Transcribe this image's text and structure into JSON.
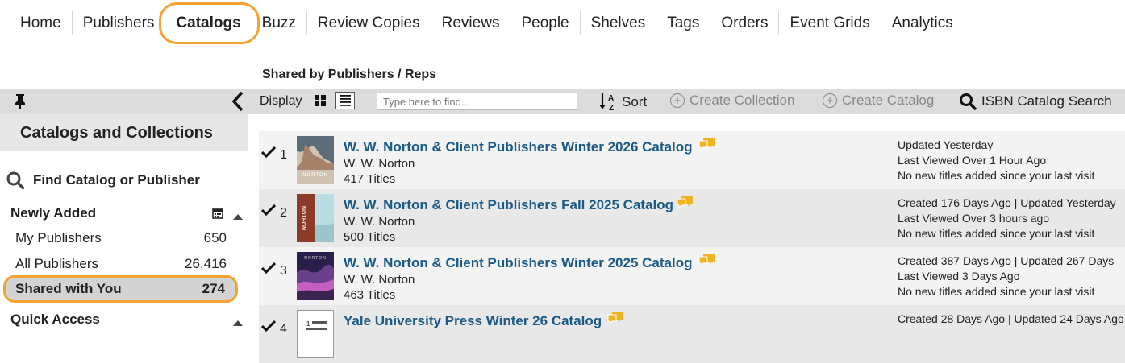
{
  "nav": {
    "items": [
      {
        "label": "Home"
      },
      {
        "label": "Publishers"
      },
      {
        "label": "Catalogs"
      },
      {
        "label": "Buzz"
      },
      {
        "label": "Review Copies"
      },
      {
        "label": "Reviews"
      },
      {
        "label": "People"
      },
      {
        "label": "Shelves"
      },
      {
        "label": "Tags"
      },
      {
        "label": "Orders"
      },
      {
        "label": "Event Grids"
      },
      {
        "label": "Analytics"
      }
    ],
    "active": "Catalogs"
  },
  "section_label": "Shared by Publishers / Reps",
  "toolbar": {
    "display_label": "Display",
    "find_placeholder": "Type here to find...",
    "sort_label": "Sort",
    "create_collection_label": "Create Collection",
    "create_catalog_label": "Create Catalog",
    "isbn_search_label": "ISBN Catalog Search"
  },
  "sidebar": {
    "title": "Catalogs and Collections",
    "find_label": "Find Catalog or Publisher",
    "newly_added_label": "Newly Added",
    "items": [
      {
        "label": "My Publishers",
        "count": "650"
      },
      {
        "label": "All Publishers",
        "count": "26,416"
      },
      {
        "label": "Shared with You",
        "count": "274"
      }
    ],
    "quick_access_label": "Quick Access"
  },
  "catalogs": [
    {
      "index": "1",
      "title": "W. W. Norton & Client Publishers Winter 2026 Catalog",
      "publisher": "W. W. Norton",
      "titles": "417 Titles",
      "meta_line1": "Updated Yesterday",
      "meta_line2": "Last Viewed Over 1 Hour Ago",
      "meta_line3": "No new titles added since your last visit",
      "cover_text": "NORTON"
    },
    {
      "index": "2",
      "title": "W. W. Norton & Client Publishers Fall 2025 Catalog",
      "publisher": "W. W. Norton",
      "titles": "500 Titles",
      "meta_line1": "Created 176 Days Ago  |  Updated Yesterday",
      "meta_line2": "Last Viewed Over 3 hours ago",
      "meta_line3": "No new titles added since your last visit",
      "cover_text": "NORTON"
    },
    {
      "index": "3",
      "title": "W. W. Norton & Client Publishers Winter 2025 Catalog",
      "publisher": "W. W. Norton",
      "titles": "463 Titles",
      "meta_line1": "Created 387 Days Ago  |  Updated 267 Days",
      "meta_line2": "Last Viewed 3 Days Ago",
      "meta_line3": "No new titles added since your last visit",
      "cover_text": "NORTON"
    },
    {
      "index": "4",
      "title": "Yale University Press Winter 26 Catalog",
      "publisher": "",
      "titles": "",
      "meta_line1": "Created 28 Days Ago  |  Updated 24 Days Ago",
      "meta_line2": "",
      "meta_line3": "",
      "cover_text": ""
    }
  ],
  "colors": {
    "highlight_ring": "#f2a332",
    "title_link": "#1a5a86",
    "chat_icon": "#f0b323",
    "toolbar_bg": "#dcdcdc"
  }
}
